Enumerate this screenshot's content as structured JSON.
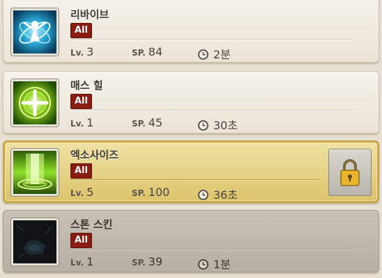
{
  "skills": [
    {
      "name": "리바이브",
      "badge": "All",
      "level_label": "Lv.",
      "level": "3",
      "sp_label": "SP.",
      "sp": "84",
      "time": "2분",
      "icon": "revive-icon"
    },
    {
      "name": "매스 힐",
      "badge": "All",
      "level_label": "Lv.",
      "level": "1",
      "sp_label": "SP.",
      "sp": "45",
      "time": "30초",
      "icon": "mass-heal-icon"
    },
    {
      "name": "엑소사이즈",
      "badge": "All",
      "level_label": "Lv.",
      "level": "5",
      "sp_label": "SP.",
      "sp": "100",
      "time": "36초",
      "icon": "exorcise-icon",
      "selected": true,
      "locked": true
    },
    {
      "name": "스톤 스킨",
      "badge": "All",
      "level_label": "Lv.",
      "level": "1",
      "sp_label": "SP.",
      "sp": "39",
      "time": "1분",
      "icon": "stone-skin-icon",
      "disabled": true
    }
  ],
  "colors": {
    "badge": "#8a1d12",
    "selected_border": "#c9a84a",
    "card_bg": "#f3eee5"
  }
}
